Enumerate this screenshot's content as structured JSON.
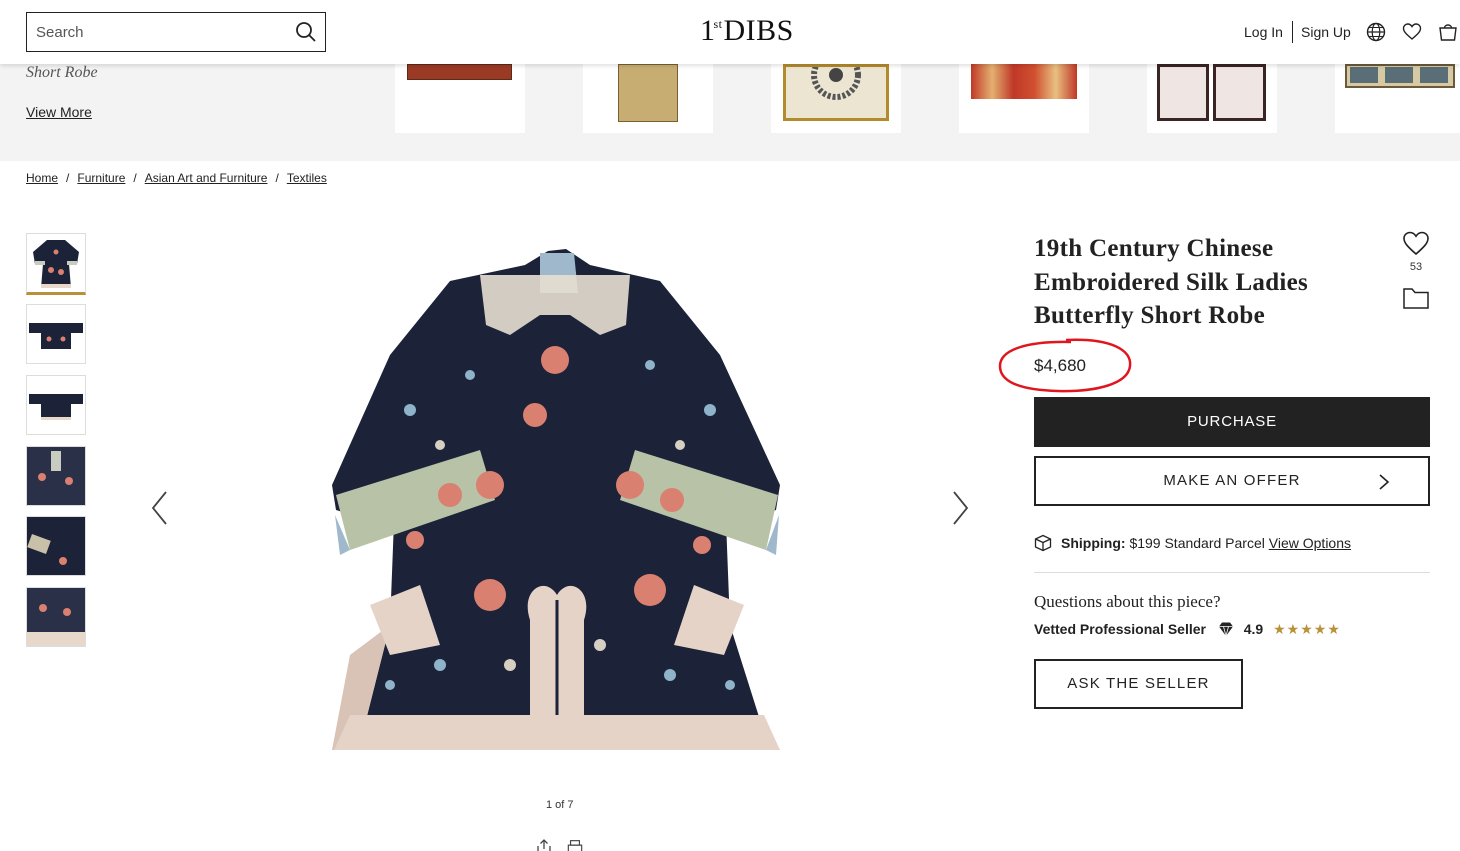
{
  "header": {
    "search_placeholder": "Search",
    "logo_main": "DIBS",
    "logo_prefix": "1",
    "logo_super": "st",
    "login": "Log In",
    "signup": "Sign Up",
    "icons": [
      "search-icon",
      "globe-icon",
      "heart-icon",
      "bag-icon"
    ]
  },
  "recent_strip": {
    "subtitle": "Short Robe",
    "view_more": "View More"
  },
  "breadcrumb": {
    "items": [
      "Home",
      "Furniture",
      "Asian Art and Furniture",
      "Textiles"
    ],
    "separator": "/"
  },
  "gallery": {
    "counter": "1 of 7",
    "active_thumbnail": 1
  },
  "product": {
    "title": "19th Century Chinese Embroidered Silk Ladies Butterfly Short Robe",
    "favorites_count": "53",
    "price": "$4,680",
    "purchase_label": "PURCHASE",
    "offer_label": "MAKE AN OFFER",
    "shipping_label": "Shipping:",
    "shipping_value": "$199 Standard Parcel",
    "shipping_link": "View Options",
    "questions": "Questions about this piece?",
    "seller_label": "Vetted Professional Seller",
    "seller_rating": "4.9",
    "stars": "★★★★★",
    "ask_label": "ASK THE SELLER"
  },
  "colors": {
    "accent_gold": "#b8913a",
    "annotation_red": "#e0161e",
    "robe_navy": "#1c2238"
  }
}
